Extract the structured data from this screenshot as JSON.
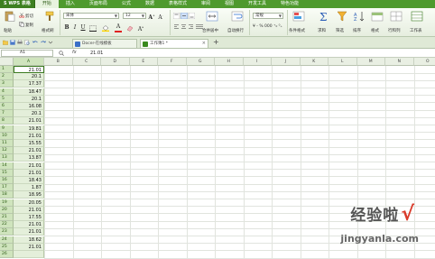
{
  "menubar": {
    "app_label": "S WPS 表格",
    "items": [
      "开始",
      "插入",
      "页面布局",
      "公式",
      "数据",
      "表格样式",
      "审阅",
      "视图",
      "开发工具",
      "特色功能"
    ]
  },
  "ribbon": {
    "cut_label": "剪切",
    "copy_label": "复制",
    "format_painter_label": "格式刷",
    "paste_label": "粘贴",
    "font_name": "宋体",
    "font_size": "12",
    "merge_label": "合并居中",
    "wrap_label": "自动换行",
    "number_format": "常规",
    "cond_format_label": "条件格式",
    "table_style_label": "表格样式",
    "sum_label": "求和",
    "filter_label": "筛选",
    "sort_label": "排序",
    "format_label": "格式",
    "rowcol_label": "行和列",
    "sheet_label": "工作表"
  },
  "tabs": {
    "items": [
      {
        "label": "Docer-在线模板",
        "active": false
      },
      {
        "label": "工作簿1 *",
        "active": true
      }
    ],
    "add_label": "+"
  },
  "formula_bar": {
    "cell_ref": "A1",
    "fx_label": "fx",
    "value": "21.01"
  },
  "columns": [
    "A",
    "B",
    "C",
    "D",
    "E",
    "F",
    "G",
    "H",
    "I",
    "J",
    "K",
    "L",
    "M",
    "N",
    "O"
  ],
  "rows": [
    {
      "n": "1",
      "a": "21.01"
    },
    {
      "n": "2",
      "a": "20.1"
    },
    {
      "n": "3",
      "a": "17.37"
    },
    {
      "n": "4",
      "a": "18.47"
    },
    {
      "n": "5",
      "a": "20.1"
    },
    {
      "n": "6",
      "a": "16.08"
    },
    {
      "n": "7",
      "a": "20.1"
    },
    {
      "n": "8",
      "a": "21.01"
    },
    {
      "n": "9",
      "a": "19.81"
    },
    {
      "n": "10",
      "a": "21.01"
    },
    {
      "n": "11",
      "a": "15.55"
    },
    {
      "n": "12",
      "a": "21.01"
    },
    {
      "n": "13",
      "a": "13.87"
    },
    {
      "n": "14",
      "a": "21.01"
    },
    {
      "n": "15",
      "a": "21.01"
    },
    {
      "n": "16",
      "a": "18.43"
    },
    {
      "n": "17",
      "a": "1.87"
    },
    {
      "n": "18",
      "a": "18.95"
    },
    {
      "n": "19",
      "a": "20.05"
    },
    {
      "n": "20",
      "a": "21.01"
    },
    {
      "n": "21",
      "a": "17.55"
    },
    {
      "n": "22",
      "a": "21.01"
    },
    {
      "n": "23",
      "a": "21.01"
    },
    {
      "n": "24",
      "a": "18.62"
    },
    {
      "n": "25",
      "a": "21.01"
    },
    {
      "n": "26",
      "a": ""
    }
  ],
  "watermark": {
    "text": "经验啦",
    "check": "√",
    "url": "jingyanla.com"
  },
  "colors": {
    "accent": "#4f9a2e",
    "selection": "#cfe4bd"
  }
}
